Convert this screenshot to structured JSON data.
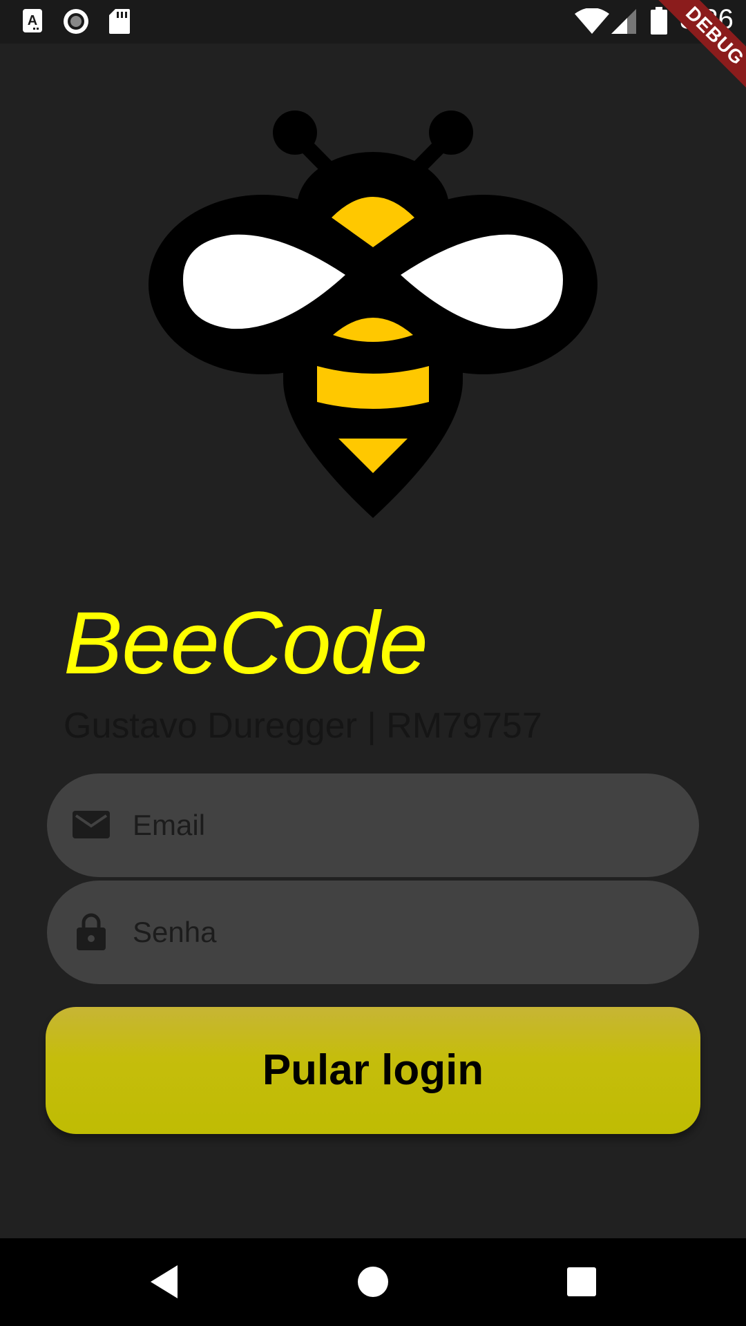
{
  "status_bar": {
    "time": "8:26",
    "icons": [
      "font-a-icon",
      "record-icon",
      "sd-card-icon",
      "wifi-icon",
      "signal-icon",
      "battery-icon"
    ]
  },
  "debug_banner": "DEBUG",
  "logo": {
    "icon": "bee-icon",
    "colors": {
      "outline": "#000000",
      "stripes": "#ffc800",
      "wings": "#ffffff"
    }
  },
  "app": {
    "title": "BeeCode",
    "subtitle": "Gustavo Duregger | RM79757"
  },
  "form": {
    "email": {
      "icon": "mail-icon",
      "placeholder": "Email",
      "value": ""
    },
    "password": {
      "icon": "lock-icon",
      "placeholder": "Senha",
      "value": ""
    }
  },
  "buttons": {
    "skip_login": "Pular login"
  },
  "nav_bar": {
    "icons": [
      "back-icon",
      "home-icon",
      "recents-icon"
    ]
  },
  "colors": {
    "background": "#212121",
    "title": "#ffff00",
    "input_bg": "#424242",
    "button": "#c5bd0c"
  }
}
